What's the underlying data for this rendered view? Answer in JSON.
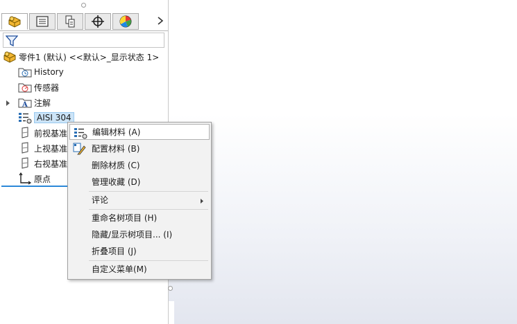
{
  "tabs": [
    {
      "icon": "featuremanager-part-icon"
    },
    {
      "icon": "propertymanager-icon"
    },
    {
      "icon": "configurationmanager-icon"
    },
    {
      "icon": "dimxpert-icon"
    },
    {
      "icon": "display-manager-icon"
    }
  ],
  "tab_more_icon": "chevron-right-icon",
  "filter_icon": "filter-icon",
  "tree": {
    "root": "零件1 (默认) <<默认>_显示状态 1>",
    "items": [
      {
        "label": "History",
        "icon": "history-folder-icon"
      },
      {
        "label": "传感器",
        "icon": "sensor-folder-icon"
      },
      {
        "label": "注解",
        "icon": "annotation-folder-icon"
      },
      {
        "label": "AISI 304",
        "icon": "material-icon"
      },
      {
        "label": "前视基准",
        "icon": "plane-icon"
      },
      {
        "label": "上视基准",
        "icon": "plane-icon"
      },
      {
        "label": "右视基准",
        "icon": "plane-icon"
      },
      {
        "label": "原点",
        "icon": "origin-icon"
      }
    ]
  },
  "context_menu": {
    "items": [
      {
        "label": "编辑材料 (A)",
        "icon": "edit-material-icon"
      },
      {
        "label": "配置材料 (B)",
        "icon": "configure-material-icon"
      },
      {
        "label": "删除材质 (C)"
      },
      {
        "label": "管理收藏 (D)"
      },
      {
        "label": "评论"
      },
      {
        "label": "重命名树项目 (H)"
      },
      {
        "label": "隐藏/显示树项目... (I)"
      },
      {
        "label": "折叠项目 (J)"
      },
      {
        "label": "自定义菜单(M)"
      }
    ]
  },
  "colors": {
    "selection": "#cce4f7",
    "accent": "#2b88d8",
    "part_icon": "#f2b632"
  }
}
